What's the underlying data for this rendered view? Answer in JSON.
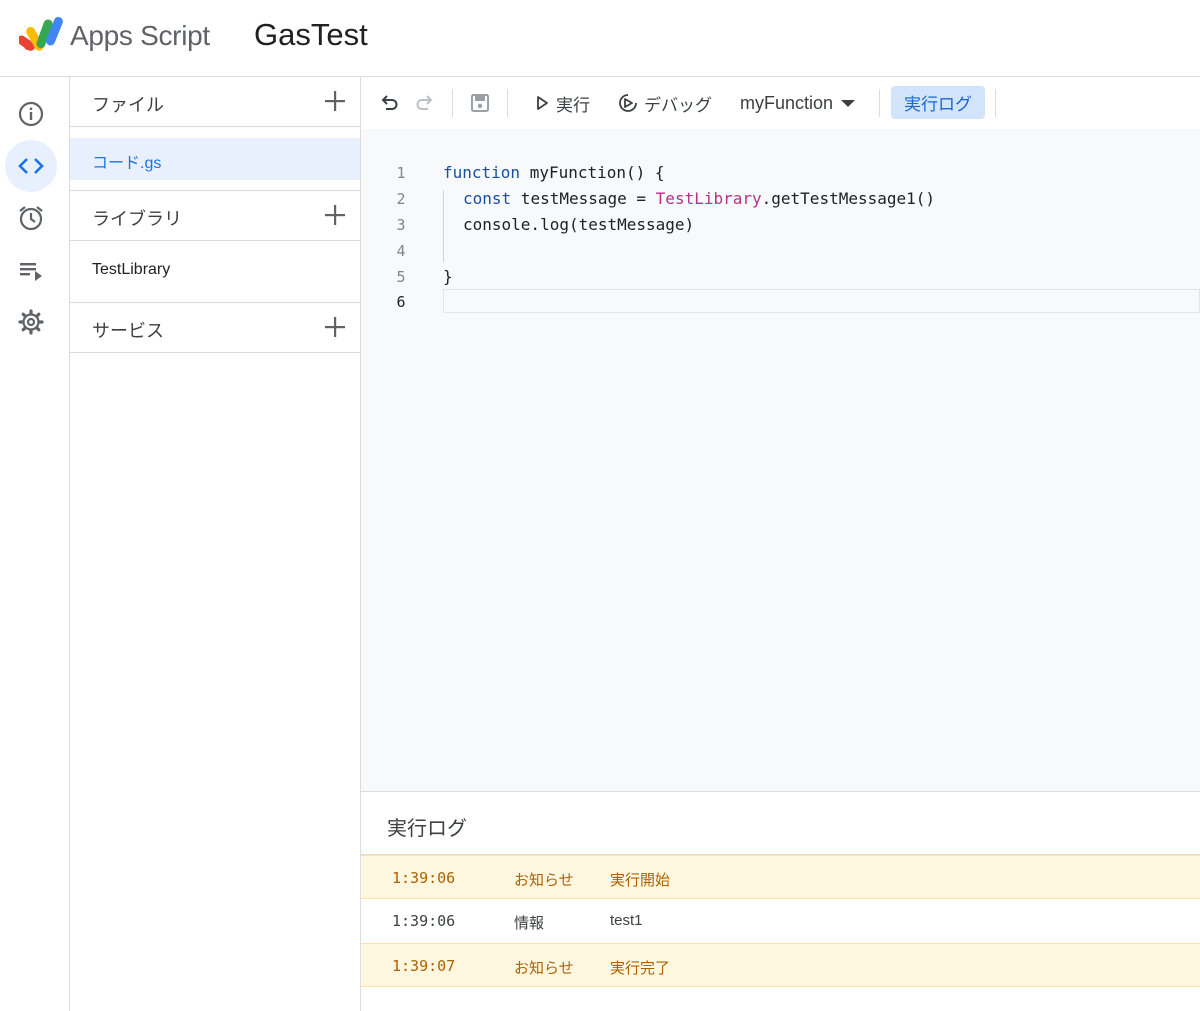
{
  "header": {
    "app_name": "Apps Script",
    "project_title": "GasTest"
  },
  "rail": {
    "items": [
      {
        "name": "overview",
        "icon": "info-icon",
        "active": false
      },
      {
        "name": "editor",
        "icon": "code-icon",
        "active": true
      },
      {
        "name": "triggers",
        "icon": "alarm-icon",
        "active": false
      },
      {
        "name": "executions",
        "icon": "playlist-play-icon",
        "active": false
      },
      {
        "name": "settings",
        "icon": "gear-icon",
        "active": false
      }
    ]
  },
  "files_panel": {
    "files_label": "ファイル",
    "files": [
      {
        "label": "コード.gs",
        "active": true
      }
    ],
    "libraries_label": "ライブラリ",
    "libraries": [
      {
        "label": "TestLibrary"
      }
    ],
    "services_label": "サービス"
  },
  "toolbar": {
    "run_label": "実行",
    "debug_label": "デバッグ",
    "function_select": "myFunction",
    "log_label": "実行ログ"
  },
  "editor": {
    "line_numbers": [
      "1",
      "2",
      "3",
      "4",
      "5",
      "6"
    ],
    "active_line": "6",
    "lines": {
      "l1_kw": "function",
      "l1_rest": " myFunction() {",
      "l2_kw": "const",
      "l2_mid": " testMessage = ",
      "l2_lib": "TestLibrary",
      "l2_rest": ".getTestMessage1()",
      "l3": "console.log(testMessage)",
      "l5": "}"
    }
  },
  "log_panel": {
    "title": "実行ログ",
    "rows": [
      {
        "time": "1:39:06",
        "level": "お知らせ",
        "message": "実行開始",
        "type": "notice"
      },
      {
        "time": "1:39:06",
        "level": "情報",
        "message": "test1",
        "type": "info"
      },
      {
        "time": "1:39:07",
        "level": "お知らせ",
        "message": "実行完了",
        "type": "notice"
      }
    ]
  },
  "colors": {
    "accent": "#1a73e8",
    "active_bg": "#e8f0fe",
    "notice_bg": "#fef7e0",
    "notice_text": "#b06000",
    "keyword": "#1a4fa0",
    "library": "#b5318c"
  }
}
